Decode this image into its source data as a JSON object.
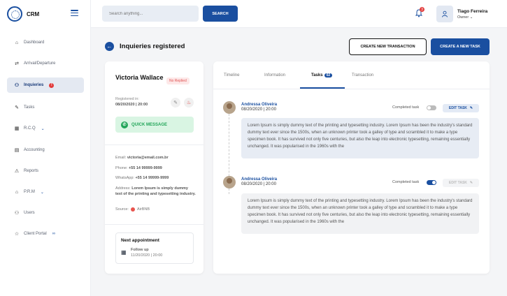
{
  "app": {
    "name": "CRM"
  },
  "search": {
    "placeholder": "Search anything...",
    "button": "SEARCH"
  },
  "notifications": {
    "count": "3"
  },
  "user": {
    "name": "Tiago Ferreira",
    "role": "Owner"
  },
  "sidebar": {
    "items": [
      {
        "label": "Dashboard",
        "icon": "home-icon"
      },
      {
        "label": "Arrival/Departure",
        "icon": "arrival-icon"
      },
      {
        "label": "Inquieries",
        "icon": "users-icon",
        "badge": "!",
        "active": true
      },
      {
        "label": "Tasks",
        "icon": "pencil-icon"
      },
      {
        "label": "R.C.Q",
        "icon": "calendar-icon"
      },
      {
        "label": "Accounting",
        "icon": "calculator-icon"
      },
      {
        "label": "Reports",
        "icon": "warning-icon"
      },
      {
        "label": "P.R.M",
        "icon": "home-icon"
      },
      {
        "label": "Users",
        "icon": "users-icon"
      },
      {
        "label": "Client Portal",
        "icon": "star-icon"
      }
    ]
  },
  "page": {
    "title": "Inquieries registered",
    "create_transaction": "CREATE NEW TRANSACTION",
    "create_task": "CREATE A NEW TASK"
  },
  "contact": {
    "name": "Victoria Wallace",
    "status": "No Replied",
    "registered_label": "Registered in:",
    "registered_date": "08/20/2020 | 20:00",
    "quick_message": "QUICK MESSAGE",
    "email_label": "Email:",
    "email": "victoria@email.com.br",
    "phone_label": "Phone:",
    "phone": "+55 14 99999-9999",
    "whatsapp_label": "WhatsApp:",
    "whatsapp": "+55 14 99999-9999",
    "address_label": "Address:",
    "address": "Lorem Ipsum is simply dummy text of the printing and typesetting industry.",
    "source_label": "Source:",
    "source": "AirBNB"
  },
  "appointment": {
    "title": "Next appointment",
    "label": "Follow up",
    "date": "11/20/2020 | 20:00"
  },
  "tabs": [
    {
      "label": "Timeline"
    },
    {
      "label": "Information"
    },
    {
      "label": "Tasks",
      "count": "02"
    },
    {
      "label": "Transaction"
    }
  ],
  "tasks": [
    {
      "name": "Andressa Oliveira",
      "date": "08/20/2020 | 20:00",
      "completed_label": "Completed task",
      "completed": false,
      "edit_label": "EDIT TASK",
      "body": "Lorem Ipsum is simply dummy text of the printing and typesetting industry. Lorem Ipsum has been the industry's standard dummy text ever since the 1500s, when an unknown printer took a galley of type and scrambled it to make a type specimen book. It has survived not only five centuries, but also the leap into electronic typesetting, remaining essentially unchanged. It was popularised in the 1960s with the"
    },
    {
      "name": "Andressa Oliveira",
      "date": "08/20/2020 | 20:00",
      "completed_label": "Completed task",
      "completed": true,
      "edit_label": "EDIT TASK",
      "body": "Lorem Ipsum is simply dummy text of the printing and typesetting industry. Lorem Ipsum has been the industry's standard dummy text ever since the 1500s, when an unknown printer took a galley of type and scrambled it to make a type specimen book. It has survived not only five centuries, but also the leap into electronic typesetting, remaining essentially unchanged. It was popularised in the 1960s with the"
    }
  ],
  "colors": {
    "primary": "#1a4fa0",
    "success": "#22a559",
    "danger": "#e23b3b"
  }
}
